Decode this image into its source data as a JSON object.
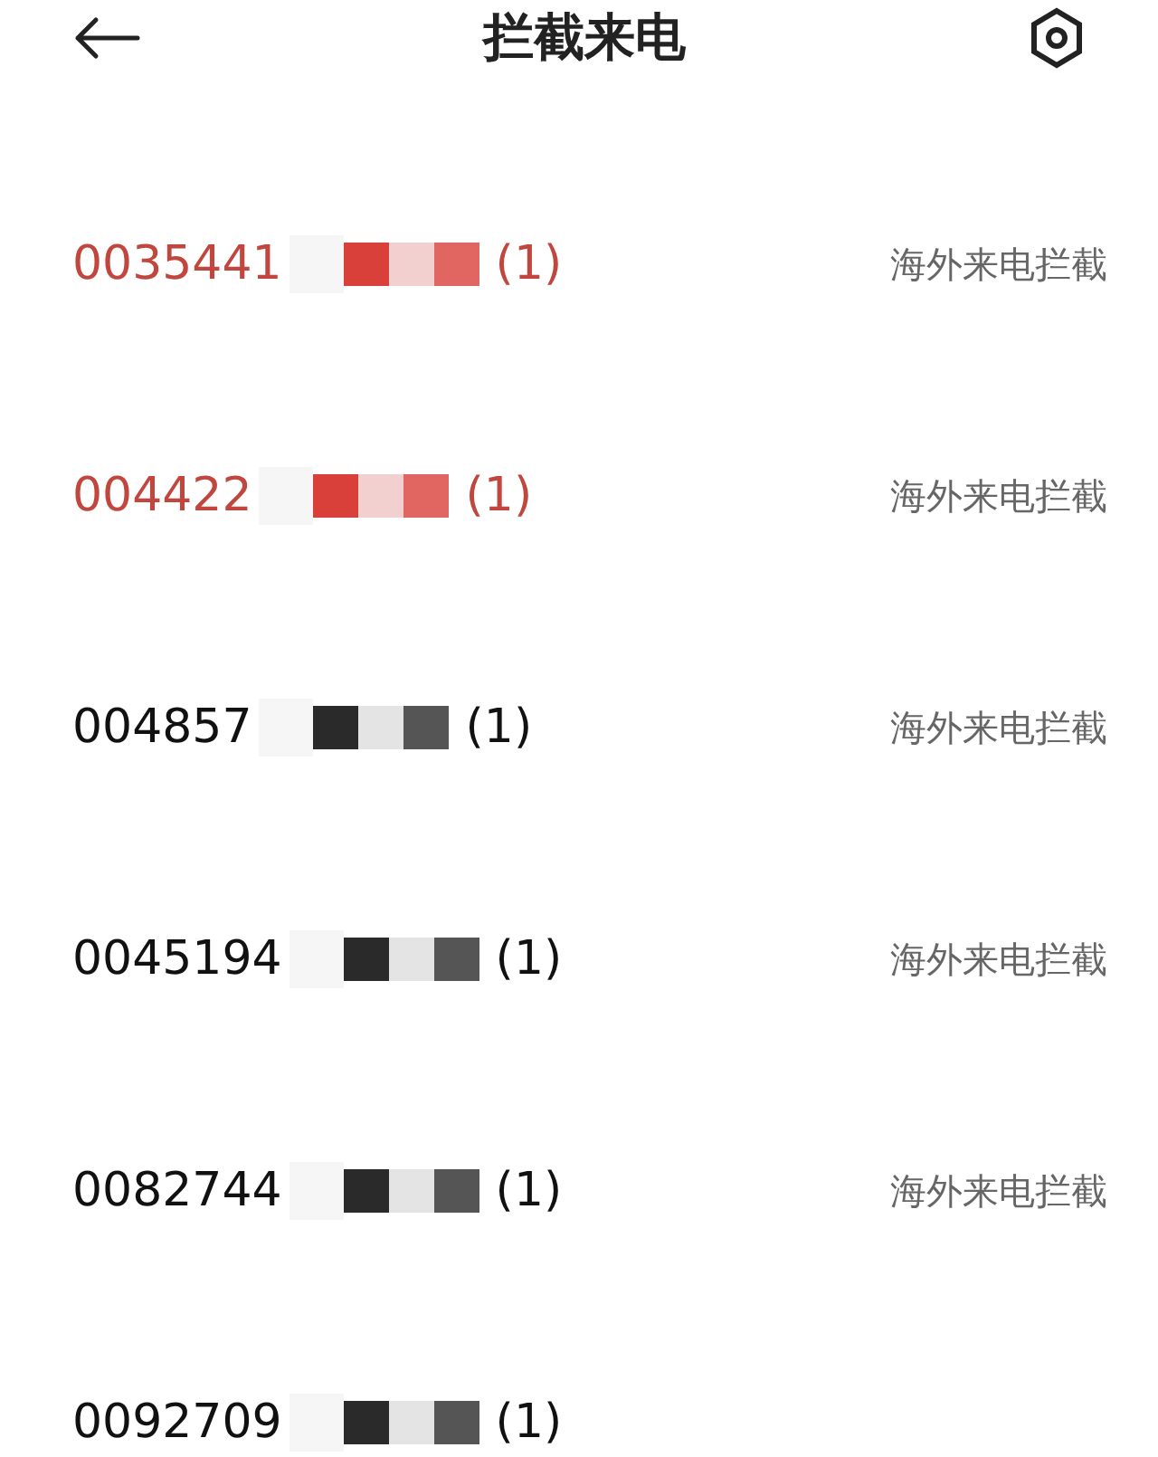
{
  "header": {
    "title": "拦截来电"
  },
  "calls": [
    {
      "number": "0035441",
      "count": "(1)",
      "label": "海外来电拦截",
      "highlighted": true
    },
    {
      "number": "004422",
      "count": "(1)",
      "label": "海外来电拦截",
      "highlighted": true
    },
    {
      "number": "004857",
      "count": "(1)",
      "label": "海外来电拦截",
      "highlighted": false
    },
    {
      "number": "0045194",
      "count": "(1)",
      "label": "海外来电拦截",
      "highlighted": false
    },
    {
      "number": "0082744",
      "count": "(1)",
      "label": "海外来电拦截",
      "highlighted": false
    },
    {
      "number": "0092709",
      "count": "(1)",
      "highlighted": false
    }
  ]
}
